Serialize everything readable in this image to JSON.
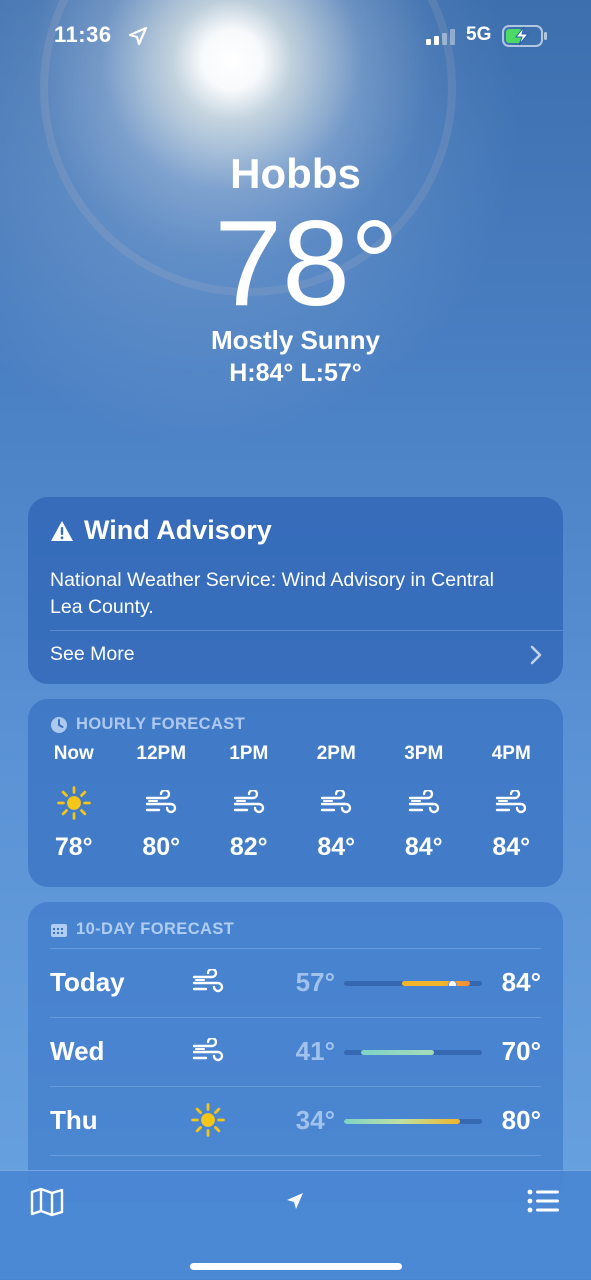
{
  "status_bar": {
    "time": "11:36",
    "network": "5G"
  },
  "current": {
    "city": "Hobbs",
    "temperature": "78°",
    "condition": "Mostly Sunny",
    "high_low": "H:84°  L:57°"
  },
  "alert": {
    "title": "Wind Advisory",
    "body": "National Weather Service: Wind Advisory in Central Lea County.",
    "see_more": "See More"
  },
  "hourly": {
    "label": "HOURLY FORECAST",
    "items": [
      {
        "time": "Now",
        "icon": "sun-icon",
        "temp": "78°"
      },
      {
        "time": "12PM",
        "icon": "wind-icon",
        "temp": "80°"
      },
      {
        "time": "1PM",
        "icon": "wind-icon",
        "temp": "82°"
      },
      {
        "time": "2PM",
        "icon": "wind-icon",
        "temp": "84°"
      },
      {
        "time": "3PM",
        "icon": "wind-icon",
        "temp": "84°"
      },
      {
        "time": "4PM",
        "icon": "wind-icon",
        "temp": "84°"
      }
    ]
  },
  "ten_day": {
    "label": "10-DAY FORECAST",
    "days": [
      {
        "day": "Today",
        "icon": "wind-icon",
        "low": "57°",
        "high": "84°",
        "range_start": 0.42,
        "range_end": 0.91,
        "current": 0.78
      },
      {
        "day": "Wed",
        "icon": "wind-icon",
        "low": "41°",
        "high": "70°",
        "range_start": 0.12,
        "range_end": 0.65
      },
      {
        "day": "Thu",
        "icon": "sun-icon",
        "low": "34°",
        "high": "80°",
        "range_start": 0.0,
        "range_end": 0.84
      }
    ]
  },
  "colors": {
    "sun": "#f5c518",
    "warm": "#f0b52a",
    "hot": "#f08a3a",
    "cool": "#7ed3c8"
  }
}
